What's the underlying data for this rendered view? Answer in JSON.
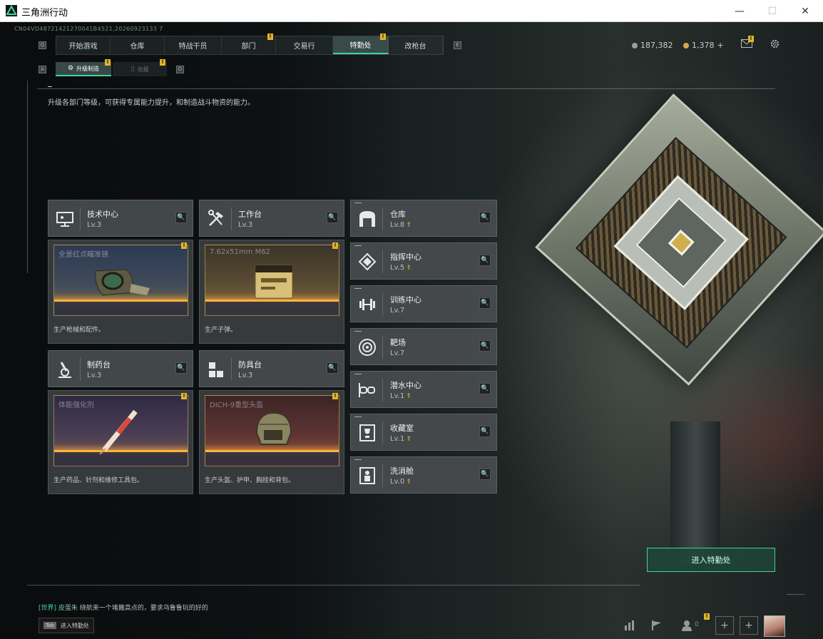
{
  "window": {
    "title": "三角洲行动",
    "minimize": "—",
    "maximize": "☐",
    "close": "✕"
  },
  "uid": "CN04VD48721421270041B4521,20260923133 7",
  "nav": {
    "tabs": [
      {
        "label": "开始游戏",
        "active": false,
        "badge": false
      },
      {
        "label": "仓库",
        "active": false,
        "badge": false
      },
      {
        "label": "特战干员",
        "active": false,
        "badge": false
      },
      {
        "label": "部门",
        "active": false,
        "badge": true
      },
      {
        "label": "交易行",
        "active": false,
        "badge": false
      },
      {
        "label": "特勤处",
        "active": true,
        "badge": true
      },
      {
        "label": "改枪台",
        "active": false,
        "badge": false
      }
    ],
    "left_key": "Q",
    "right_key": "E"
  },
  "currency": {
    "primary": "187,382",
    "secondary": "1,378",
    "secondary_add": "+"
  },
  "subtabs": {
    "active": "升级制造",
    "inactive": "收藏",
    "left_key": "A",
    "right_key": "D"
  },
  "description": "升级各部门等级，可获得专属能力提升，和制造战斗物资的能力。",
  "production": [
    {
      "name": "技术中心",
      "level": "Lv.3",
      "item": "全景红点瞄准镜",
      "caption": "生产枪械和配件。",
      "icon": "monitor-icon"
    },
    {
      "name": "工作台",
      "level": "Lv.3",
      "item": "7.62x51mm M62",
      "caption": "生产子弹。",
      "icon": "tools-icon"
    },
    {
      "name": "制药台",
      "level": "Lv.3",
      "item": "体能强化剂",
      "caption": "生产药品、针剂和维修工具包。",
      "icon": "microscope-icon"
    },
    {
      "name": "防具台",
      "level": "Lv.3",
      "item": "DICH-9重型头盔",
      "caption": "生产头盔、护甲、胸挂和背包。",
      "icon": "cubes-icon"
    }
  ],
  "facilities": [
    {
      "name": "仓库",
      "level": "Lv.8",
      "upgradable": true,
      "icon": "warehouse-icon"
    },
    {
      "name": "指挥中心",
      "level": "Lv.5",
      "upgradable": true,
      "icon": "chip-icon"
    },
    {
      "name": "训练中心",
      "level": "Lv.7",
      "upgradable": false,
      "icon": "dumbbell-icon"
    },
    {
      "name": "靶场",
      "level": "Lv.7",
      "upgradable": false,
      "icon": "target-icon"
    },
    {
      "name": "潜水中心",
      "level": "Lv.1",
      "upgradable": true,
      "icon": "diving-mask-icon"
    },
    {
      "name": "收藏室",
      "level": "Lv.1",
      "upgradable": true,
      "icon": "trophy-icon"
    },
    {
      "name": "洗消舱",
      "level": "Lv.0",
      "upgradable": true,
      "icon": "decon-pod-icon"
    }
  ],
  "search_glyph": "🔍",
  "upgrade_glyph": "⇑",
  "badge_glyph": "!",
  "enter_button": "进入特勤处",
  "chat": {
    "channel": "[世界]",
    "user": "皮蛋朱",
    "message": "绕航来一个堵撇高点的，要求乌鲁鲁玩的好的"
  },
  "tab_hint": {
    "key": "Tab",
    "label": "进入特勤处"
  },
  "friends_count": "0",
  "colors": {
    "accent": "#3ed2a0",
    "badge": "#e2b42c",
    "upgrade": "#e8b83a"
  }
}
